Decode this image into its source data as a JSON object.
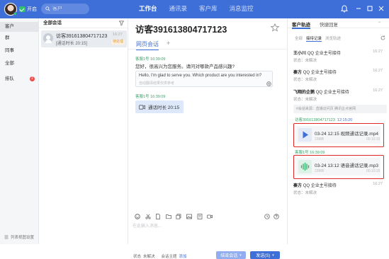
{
  "topbar": {
    "status_label": "开启",
    "search_placeholder": "客户",
    "nav": [
      "工作台",
      "通讯录",
      "客户库",
      "消息监控"
    ]
  },
  "sidebar": {
    "items": [
      {
        "label": "客户"
      },
      {
        "label": "群"
      },
      {
        "label": "同事"
      },
      {
        "label": "全部"
      },
      {
        "label": "排队",
        "badge": "2"
      }
    ],
    "footer": "列表视图设置"
  },
  "convlist": {
    "header": "全部会话",
    "items": [
      {
        "name": "访客391613804717123",
        "time": "16:27",
        "snippet": "[通话时长 20:15]",
        "tag": "待处理"
      }
    ]
  },
  "chat": {
    "title": "访客391613804717123",
    "tab": "网页会话",
    "tab_add": "+",
    "messages": [
      {
        "meta": "客服1号 16:39:09",
        "text": "您好，很高兴为您服务。请问对哪款产品感兴趣?",
        "translation": "Hello, I'm glad to serve you. Which product are you interested in?",
        "translation_note": "自动翻译结果仅供参考"
      },
      {
        "meta": "客服1号 16:39:09",
        "call": "通话时长 20:15"
      }
    ],
    "compose_placeholder": "在此输入消息...",
    "footer": {
      "status_label": "状态",
      "status_value": "未解决",
      "topic_label": "会话主题",
      "topic_action": "添加"
    },
    "end_button": "结束会话",
    "send_button": "发送(S)"
  },
  "rpanel": {
    "tabs": [
      "客户轨迹",
      "快捷回复"
    ],
    "more": "···",
    "subtabs": [
      "全部",
      "接待记录",
      "浏览轨迹"
    ],
    "tracks": [
      {
        "who": "王小川",
        "action": "QQ 企业主号接待",
        "time": "16:27",
        "status": "状态：未解决"
      },
      {
        "who": "秦方",
        "action": "QQ 企业主号接待",
        "time": "16:27",
        "status": "状态：未解决"
      },
      {
        "who": "飞翔的企鹅",
        "action": "QQ 企业主号接待",
        "time": "16:27",
        "status": "状态：未解决"
      }
    ],
    "fav_text": "#会话来源：直播访问页 腾讯企点官网",
    "visitor_meta": {
      "name": "访客391613804717123",
      "time": "12:15:20"
    },
    "agent_meta": "客服1号 16:39:09",
    "files": [
      {
        "name": "03-24 12:15 视频通话记录.mp4",
        "size": "23MB",
        "duration": "00:10:15",
        "kind": "video"
      },
      {
        "name": "03-24 13:12 语音通话记录.mp3",
        "size": "23MB",
        "duration": "00:10:15",
        "kind": "audio"
      }
    ],
    "last_track": {
      "who": "秦方",
      "action": "QQ 企业主号接待",
      "time": "16:27",
      "status": "状态：未解决"
    }
  },
  "colors": {
    "brand": "#3e6fd8",
    "highlight": "#e02828",
    "agent_green": "#3aa36a"
  }
}
